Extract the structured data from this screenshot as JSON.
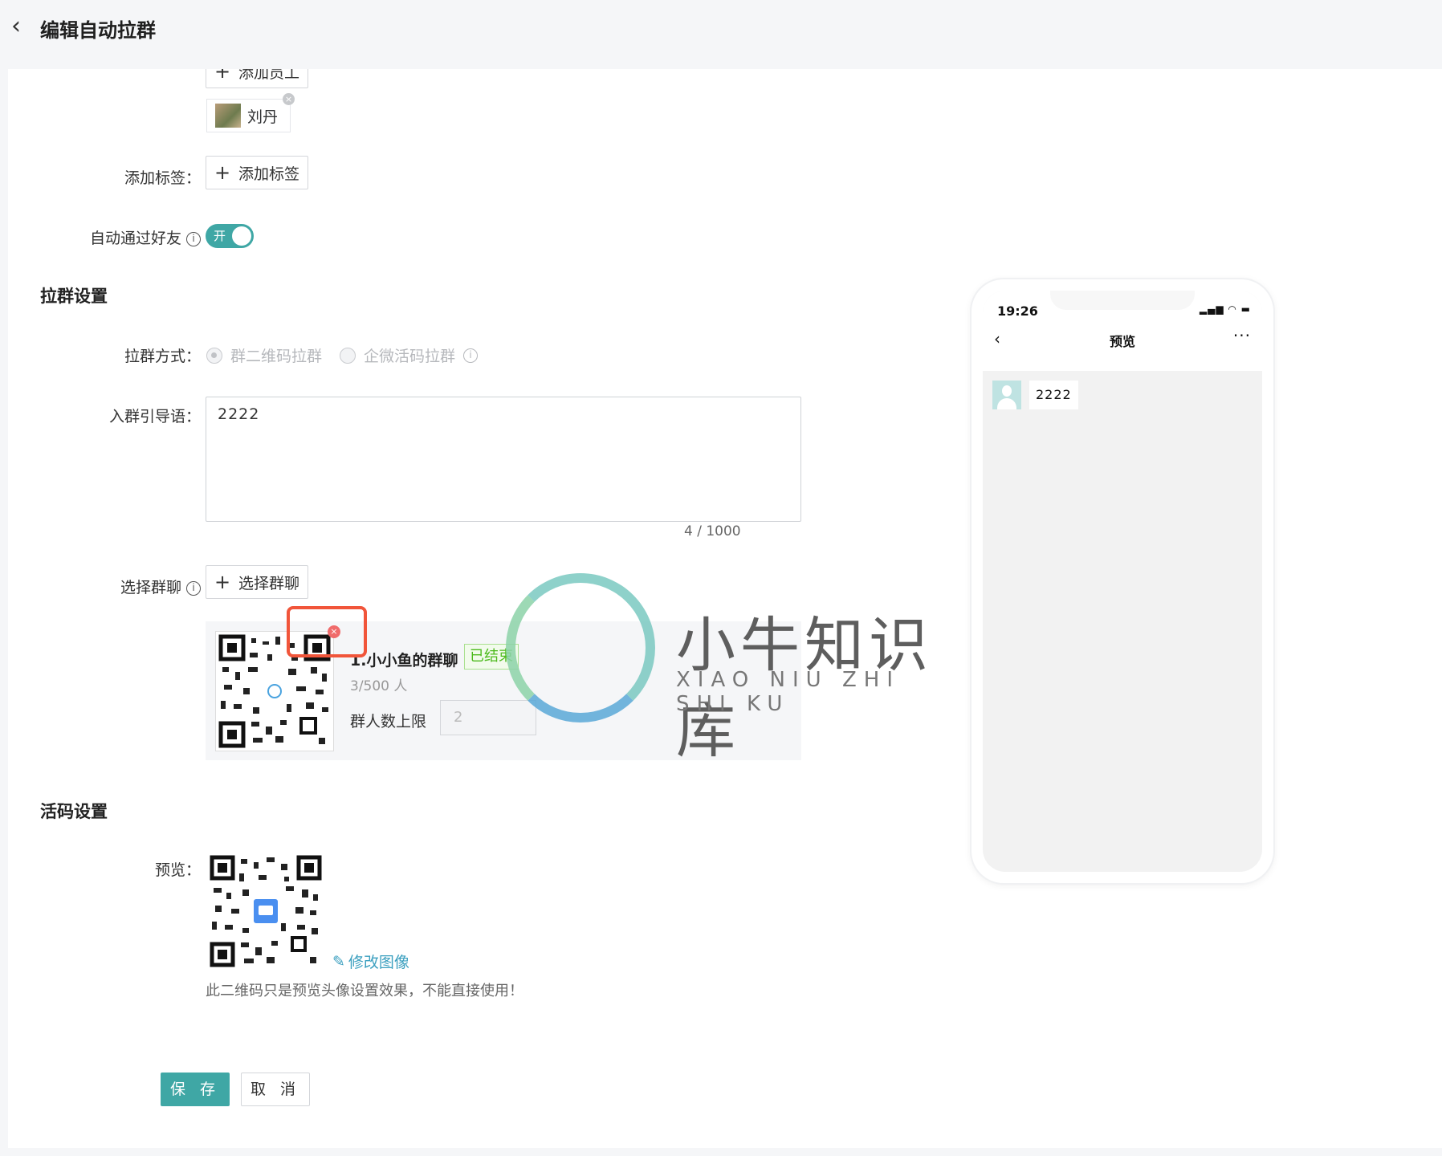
{
  "header": {
    "title": "编辑自动拉群"
  },
  "members": {
    "add_label": "添加员工",
    "chips": [
      {
        "name": "刘丹"
      }
    ]
  },
  "tags": {
    "label": "添加标签：",
    "button_label": "添加标签"
  },
  "auto_accept": {
    "label": "自动通过好友",
    "toggle_text": "开",
    "enabled": true
  },
  "group_settings": {
    "section_title": "拉群设置",
    "method_label": "拉群方式：",
    "methods": [
      {
        "label": "群二维码拉群",
        "selected": true
      },
      {
        "label": "企微活码拉群",
        "selected": false
      }
    ],
    "guide_label": "入群引导语：",
    "guide_text": "2222",
    "guide_counter": "4 / 1000",
    "select_label": "选择群聊",
    "select_button": "选择群聊",
    "group": {
      "name": "1.小小鱼的群聊",
      "status": "已结束",
      "count": "3/500 人",
      "limit_label": "群人数上限",
      "limit_value": "2"
    }
  },
  "code_settings": {
    "section_title": "活码设置",
    "preview_label": "预览：",
    "edit_link": "修改图像",
    "note": "此二维码只是预览头像设置效果，不能直接使用！"
  },
  "actions": {
    "save": "保 存",
    "cancel": "取 消"
  },
  "phone_preview": {
    "time": "19:26",
    "title": "预览",
    "more": "···",
    "message": "2222"
  },
  "watermark": {
    "title": "小牛知识库",
    "subtitle": "XIAO NIU ZHI SHI KU"
  },
  "colors": {
    "primary": "#3fa7a5",
    "ended_green": "#4cba1c",
    "highlight": "#f1553a",
    "link": "#3a9fbf"
  }
}
